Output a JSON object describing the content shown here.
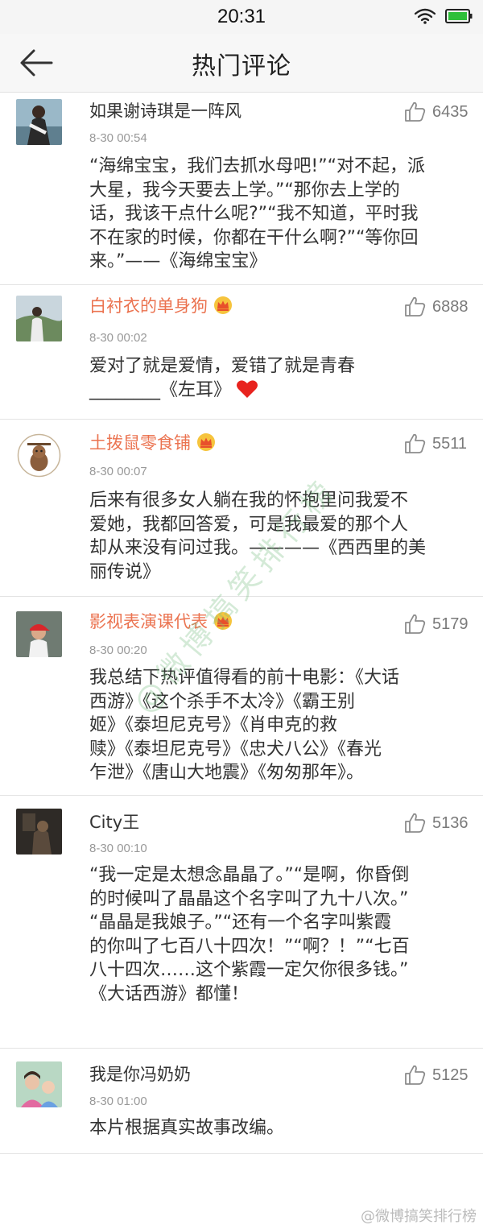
{
  "status_bar": {
    "time": "20:31"
  },
  "header": {
    "title": "热门评论"
  },
  "comments": [
    {
      "username": "如果谢诗琪是一阵风",
      "vip": false,
      "likes": "6435",
      "time": "8-30 00:54",
      "text": "“海绵宝宝，我们去抓水母吧!”“对不起，派\n大星，我今天要去上学。”“那你去上学的\n话，我该干点什么呢?”“我不知道，平时我\n不在家的时候，你都在干什么啊?”“等你回\n来。”——《海绵宝宝》"
    },
    {
      "username": "白衬衣的单身狗",
      "vip": true,
      "likes": "6888",
      "time": "8-30 00:02",
      "text": "爱对了就是爱情，爱错了就是青春\n________《左耳》"
    },
    {
      "username": "土拨鼠零食铺",
      "vip": true,
      "likes": "5511",
      "time": "8-30 00:07",
      "text": "后来有很多女人躺在我的怀抱里问我爱不\n爱她，我都回答爱，可是我最爱的那个人\n却从来没有问过我。————《西西里的美\n丽传说》"
    },
    {
      "username": "影视表演课代表",
      "vip": true,
      "likes": "5179",
      "time": "8-30 00:20",
      "text": "我总结下热评值得看的前十电影：《大话\n西游》《这个杀手不太冷》《霸王别\n姬》《泰坦尼克号》《肖申克的救\n赎》《泰坦尼克号》《忠犬八公》《春光\n乍泄》《唐山大地震》《匆匆那年》。"
    },
    {
      "username": "City王",
      "vip": false,
      "likes": "5136",
      "time": "8-30 00:10",
      "text": "“我一定是太想念晶晶了。”“是啊，你昏倒\n的时候叫了晶晶这个名字叫了九十八次。”\n“晶晶是我娘子。”“还有一个名字叫紫霞\n的你叫了七百八十四次！”“啊？！”“七百\n八十四次……这个紫霞一定欠你很多钱。”\n《大话西游》都懂！"
    },
    {
      "username": "我是你冯奶奶",
      "vip": false,
      "likes": "5125",
      "time": "8-30 01:00",
      "text": "本片根据真实故事改编。"
    }
  ],
  "watermark": "@微博搞笑排行榜",
  "footer_watermark": "@微博搞笑排行榜",
  "colors": {
    "vip_name": "#eb7350",
    "battery": "#2fbf3a",
    "heart": "#e8231e"
  },
  "icons": [
    "wifi-icon",
    "battery-icon",
    "back-arrow-icon",
    "thumbs-up-icon",
    "vip-crown-icon",
    "heart-icon"
  ]
}
